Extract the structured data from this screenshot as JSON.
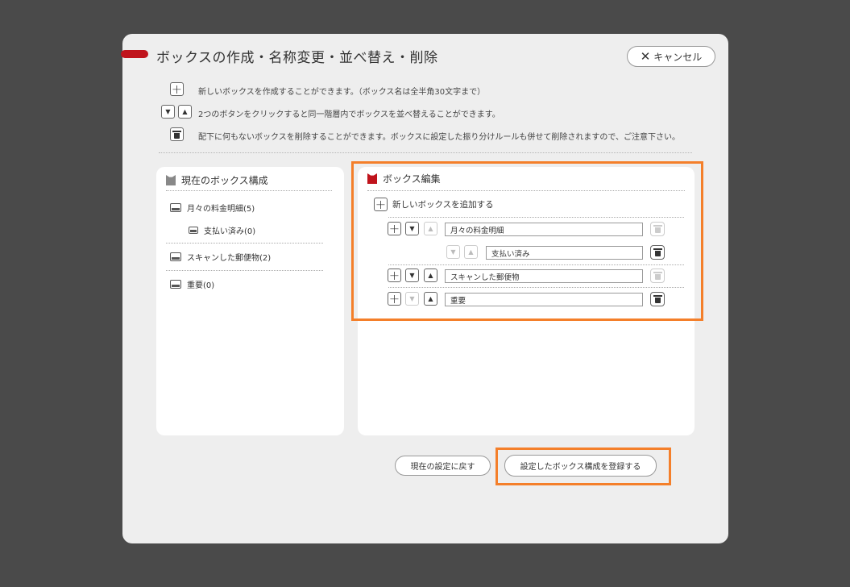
{
  "dialog": {
    "title": "ボックスの作成・名称変更・並べ替え・削除",
    "cancel_label": "キャンセル"
  },
  "help": [
    {
      "icon": "plus-icon",
      "text": "新しいボックスを作成することができます。（ボックス名は全半角30文字まで）"
    },
    {
      "icon": "up-down-arrows-icon",
      "text": "2つのボタンをクリックすると同一階層内でボックスを並べ替えることができます。"
    },
    {
      "icon": "trash-icon",
      "text": "配下に何もないボックスを削除することができます。ボックスに設定した振り分けルールも併せて削除されますので、ご注意下さい。"
    }
  ],
  "current_panel": {
    "title": "現在のボックス構成",
    "items": [
      {
        "label": "月々の料金明細(5)",
        "level": 0
      },
      {
        "label": "支払い済み(0)",
        "level": 1
      },
      {
        "label": "スキャンした郵便物(2)",
        "level": 0
      },
      {
        "label": "重要(0)",
        "level": 0
      }
    ]
  },
  "edit_panel": {
    "title": "ボックス編集",
    "add_label": "新しいボックスを追加する",
    "rows": [
      {
        "value": "月々の料金明細",
        "level": 0,
        "down_enabled": true,
        "up_enabled": false,
        "trash_enabled": false
      },
      {
        "value": "支払い済み",
        "level": 1,
        "down_enabled": false,
        "up_enabled": false,
        "trash_enabled": true
      },
      {
        "value": "スキャンした郵便物",
        "level": 0,
        "down_enabled": true,
        "up_enabled": true,
        "trash_enabled": false
      },
      {
        "value": "重要",
        "level": 0,
        "down_enabled": false,
        "up_enabled": true,
        "trash_enabled": true
      }
    ]
  },
  "footer": {
    "reset_label": "現在の設定に戻す",
    "register_label": "設定したボックス構成を登録する"
  },
  "colors": {
    "accent_red": "#c0141c",
    "highlight_orange": "#f47f2a",
    "backdrop": "#4a4a4a"
  },
  "glyphs": {
    "plus": "+",
    "up": "▲",
    "down": "▼",
    "close": "✕"
  }
}
